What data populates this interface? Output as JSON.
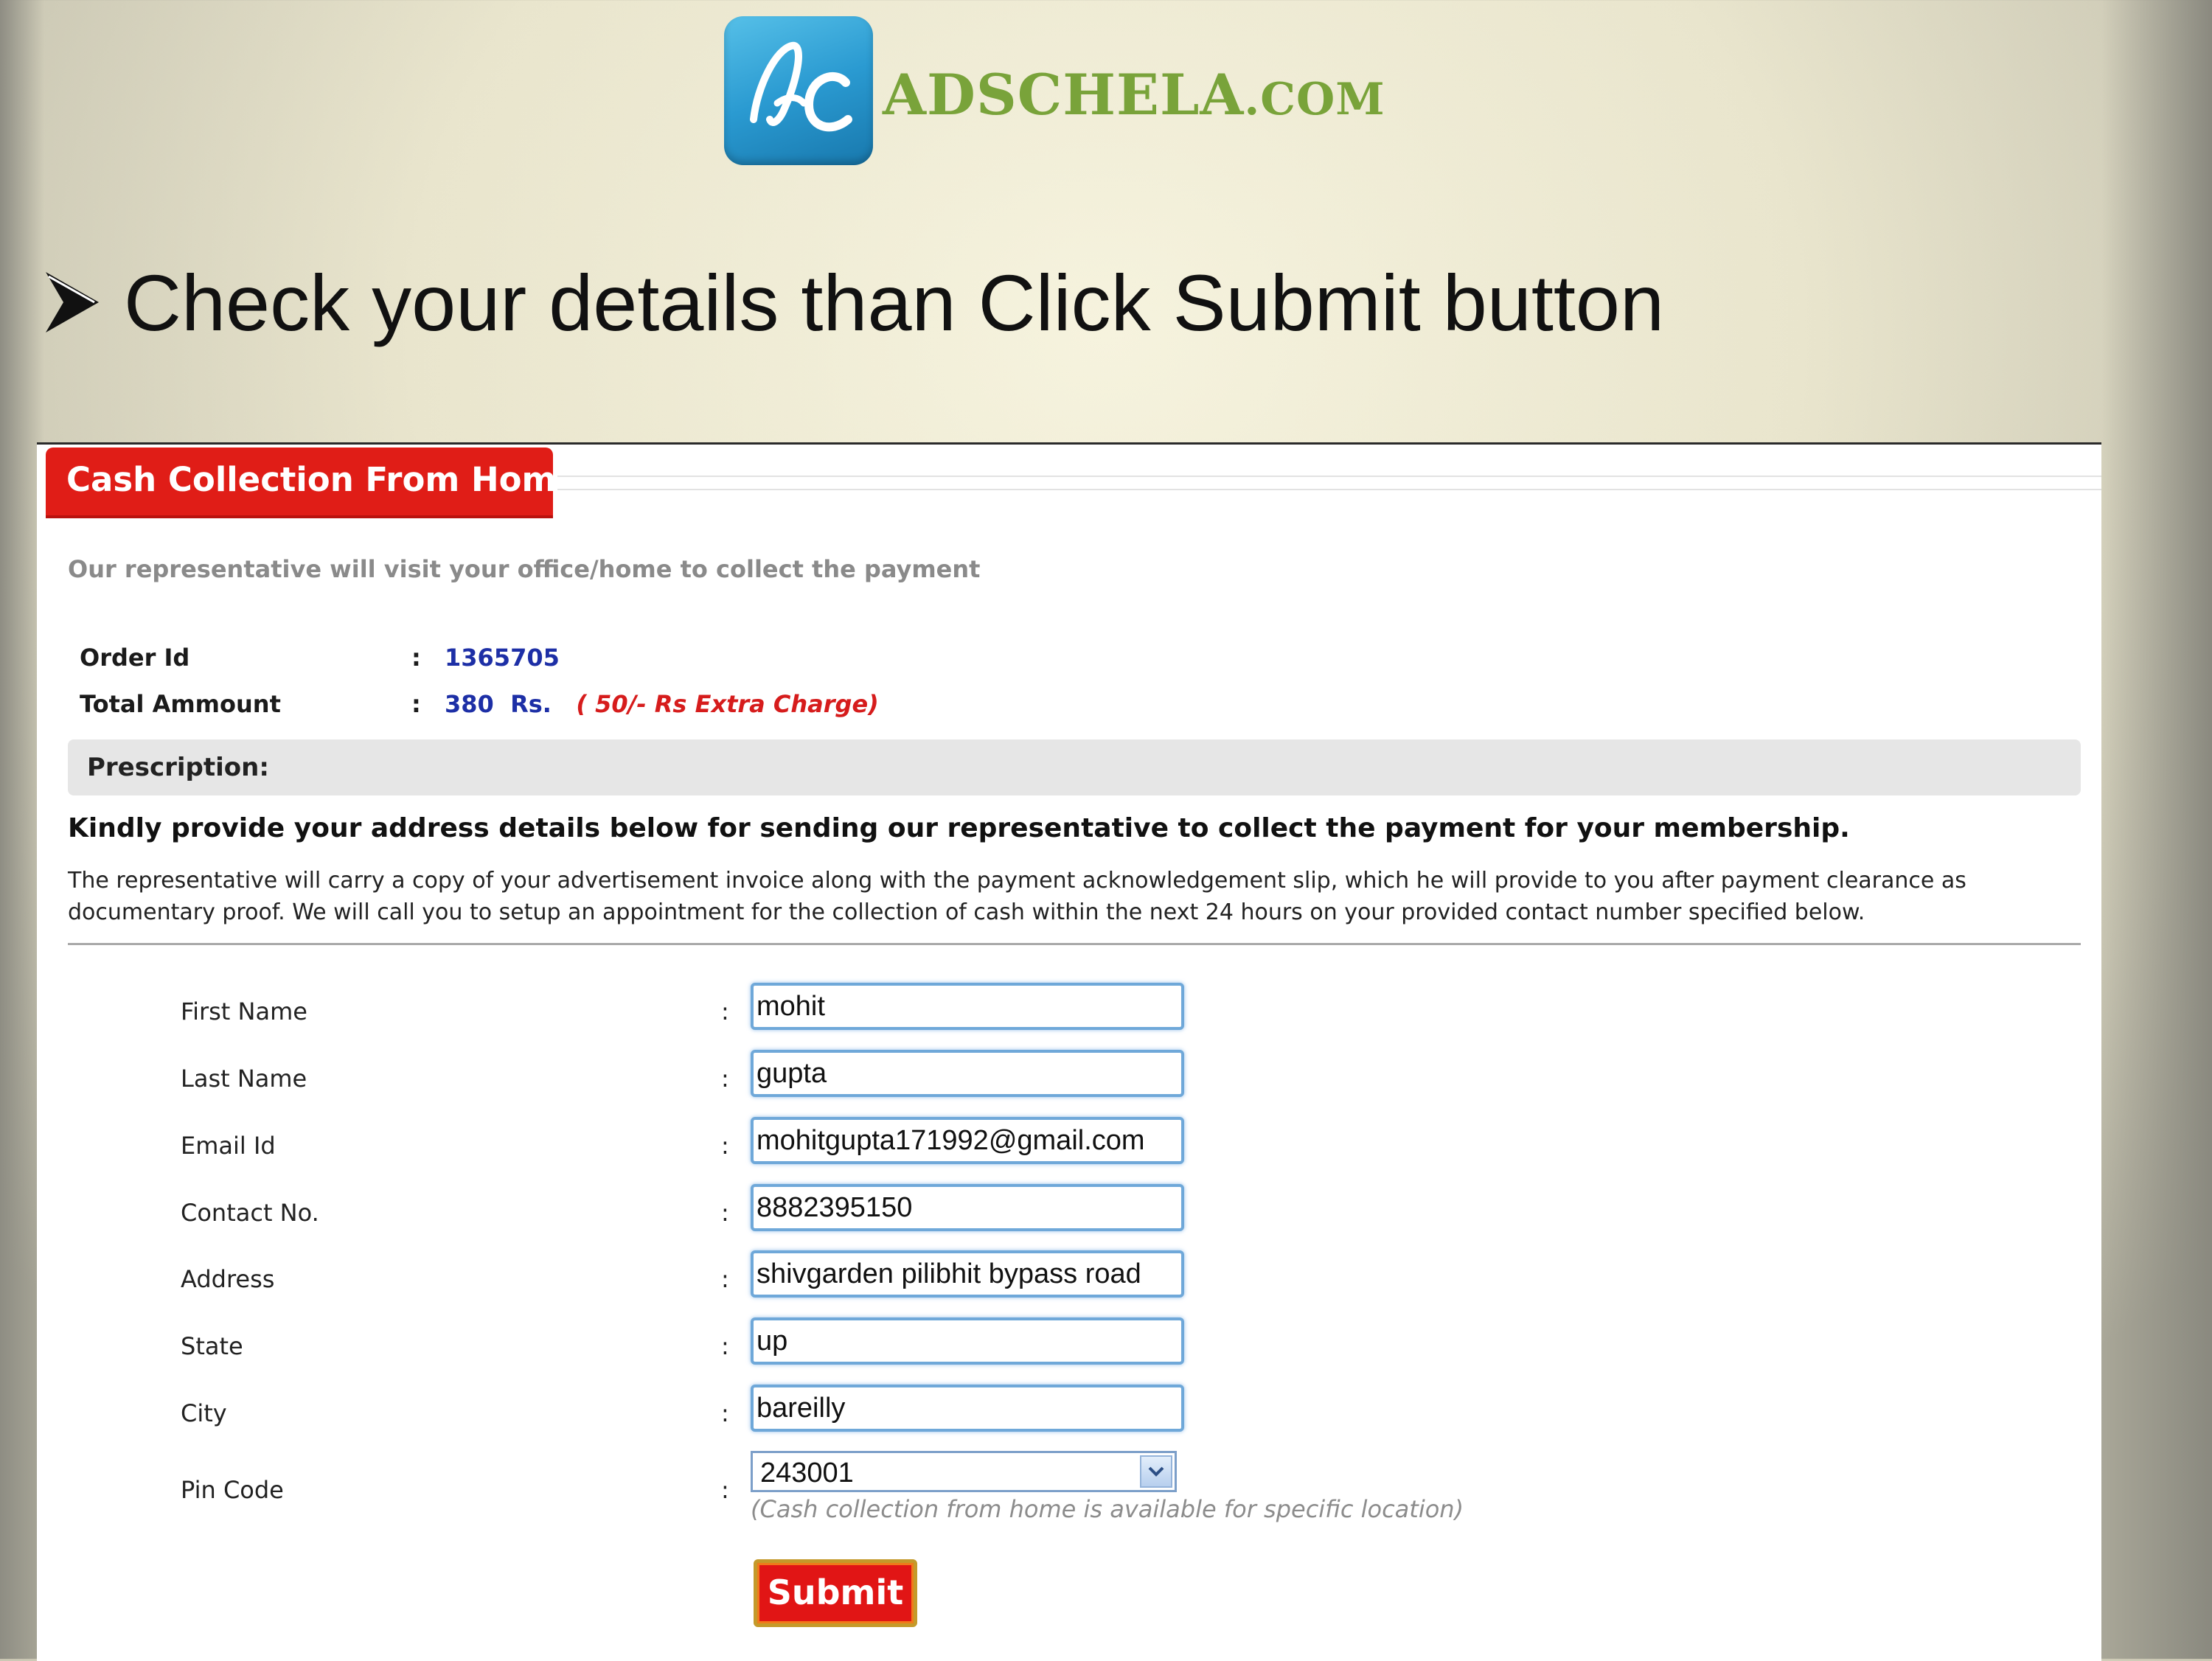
{
  "logo": {
    "brand_main": "ADSCHELA",
    "brand_suffix": ".COM",
    "mark_letters": "ac"
  },
  "heading": {
    "text": "Check your details than Click Submit button"
  },
  "panel": {
    "title": "Cash Collection From Home",
    "subtitle": "Our representative will visit your office/home to collect the payment",
    "order": {
      "label": "Order Id",
      "colon": ":",
      "value": "1365705"
    },
    "total": {
      "label": "Total Ammount",
      "colon": ":",
      "amount": "380",
      "currency": "Rs.",
      "extra": "( 50/- Rs Extra Charge)"
    },
    "prescription_label": "Prescription:",
    "kindly_text": "Kindly provide your address details below for sending our representative to collect the payment for your membership.",
    "info_paragraph": "The representative will carry a copy of your advertisement invoice along with the payment acknowledgement slip, which he will provide to you after payment clearance as documentary proof. We will call you to setup an appointment for the collection of cash within the next 24 hours on your provided contact number specified below."
  },
  "form": {
    "colon": ":",
    "fields": [
      {
        "label": "First Name",
        "value": "mohit"
      },
      {
        "label": "Last Name",
        "value": "gupta"
      },
      {
        "label": "Email Id",
        "value": "mohitgupta171992@gmail.com"
      },
      {
        "label": "Contact No.",
        "value": "8882395150"
      },
      {
        "label": "Address",
        "value": "shivgarden pilibhit bypass road"
      },
      {
        "label": "State",
        "value": "up"
      },
      {
        "label": "City",
        "value": "bareilly"
      }
    ],
    "pincode": {
      "label": "Pin Code",
      "value": "243001",
      "note": "(Cash collection from home is available for specific location)"
    },
    "submit_label": "Submit"
  },
  "colors": {
    "brand_green": "#79a33a",
    "tab_red": "#e01d17",
    "value_blue": "#1d2fa6",
    "input_border": "#6fa8d9"
  }
}
